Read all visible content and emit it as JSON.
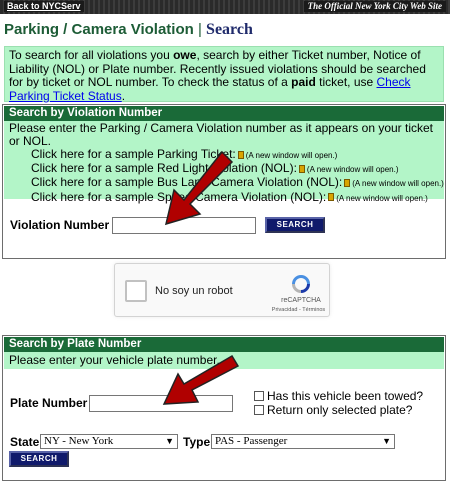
{
  "topbar": {
    "back_link": "Back to NYCServ",
    "official": "The Official New York City Web Site"
  },
  "header": {
    "title": "Parking / Camera Violation",
    "separator": "|",
    "search": "Search"
  },
  "intro": {
    "text_1": "To search for all violations you ",
    "owe": "owe",
    "text_2": ", search by either Ticket number, Notice of Liability (NOL) or Plate number. Recently issued violations should be searched for by ticket or NOL number. To check the status of a ",
    "paid": "paid",
    "text_3": " ticket, use ",
    "link": "Check Parking Ticket Status",
    "text_4": "."
  },
  "violation_panel": {
    "heading": "Search by Violation Number",
    "instructions": "Please enter the Parking / Camera Violation number as it appears on your ticket or NOL.",
    "samples": [
      {
        "label": "Click here for a sample Parking Ticket:",
        "note": "(A new window will open.)"
      },
      {
        "label": "Click here for a sample Red Light Violation (NOL):",
        "note": "(A new window will open.)"
      },
      {
        "label": "Click here for a sample Bus Lane Camera Violation (NOL):",
        "note": "(A new window will open.)"
      },
      {
        "label": "Click here for a sample Speed Camera Violation (NOL):",
        "note": "(A new window will open.)"
      }
    ],
    "field_label": "Violation Number",
    "field_value": "",
    "button": "SEARCH"
  },
  "captcha": {
    "label": "No soy un robot",
    "brand": "reCAPTCHA",
    "links": "Privacidad - Términos"
  },
  "plate_panel": {
    "heading": "Search by Plate Number",
    "instructions": "Please enter your vehicle plate number.",
    "field_label": "Plate Number",
    "field_value": "",
    "towed_label": "Has this vehicle been towed?",
    "selected_label": "Return only selected plate?",
    "state_label": "State",
    "state_value": "NY - New York",
    "type_label": "Type",
    "type_value": "PAS - Passenger",
    "button": "SEARCH"
  },
  "colors": {
    "panel_green": "#1a6a38",
    "mint": "#b3f5c8",
    "button_navy": "#101a6b",
    "arrow_red": "#b00000"
  }
}
